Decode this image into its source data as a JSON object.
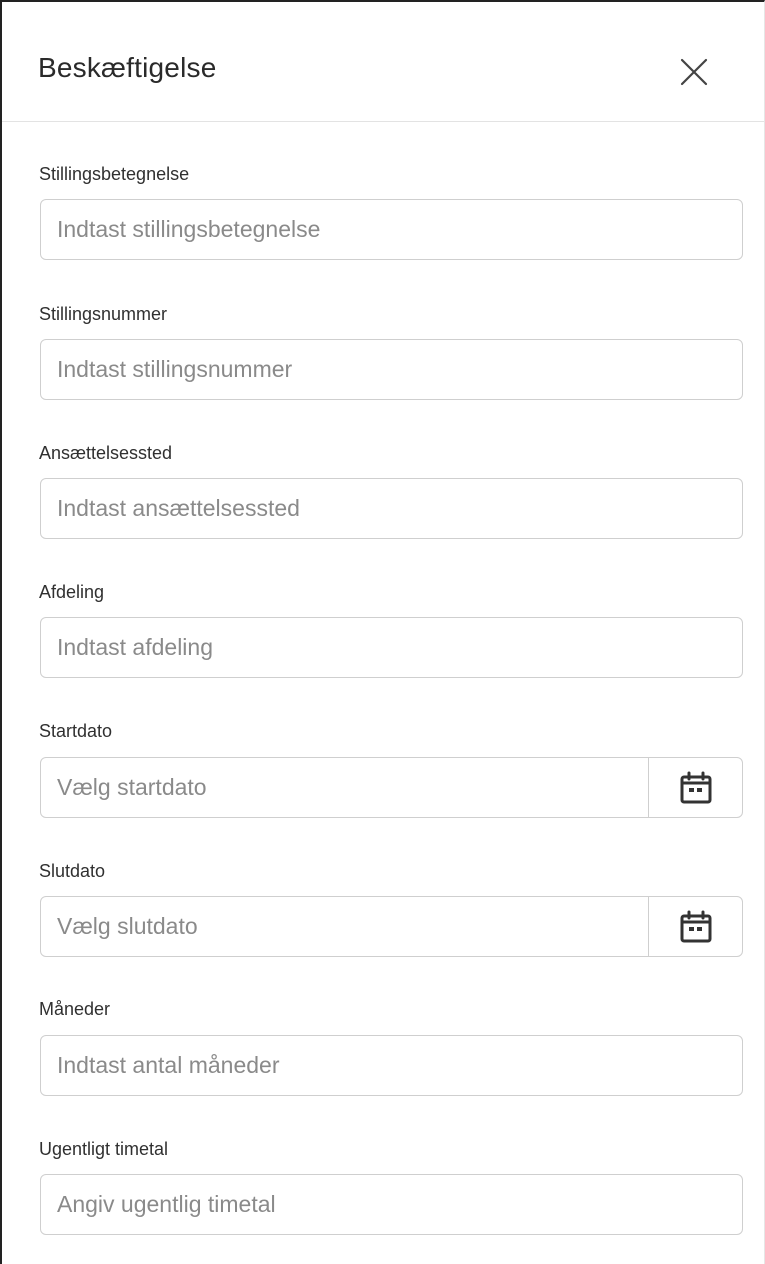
{
  "dialog": {
    "title": "Beskæftigelse",
    "close_icon": "close-icon"
  },
  "fields": {
    "job_title": {
      "label": "Stillingsbetegnelse",
      "placeholder": "Indtast stillingsbetegnelse",
      "value": ""
    },
    "job_number": {
      "label": "Stillingsnummer",
      "placeholder": "Indtast stillingsnummer",
      "value": ""
    },
    "workplace": {
      "label": "Ansættelsessted",
      "placeholder": "Indtast ansættelsessted",
      "value": ""
    },
    "department": {
      "label": "Afdeling",
      "placeholder": "Indtast afdeling",
      "value": ""
    },
    "start_date": {
      "label": "Startdato",
      "placeholder": "Vælg startdato",
      "value": "",
      "icon": "calendar-icon"
    },
    "end_date": {
      "label": "Slutdato",
      "placeholder": "Vælg slutdato",
      "value": "",
      "icon": "calendar-icon"
    },
    "months": {
      "label": "Måneder",
      "placeholder": "Indtast antal måneder",
      "value": ""
    },
    "weekly_hours": {
      "label": "Ugentligt timetal",
      "placeholder": "Angiv ugentlig timetal",
      "value": ""
    }
  },
  "colors": {
    "text": "#333333",
    "placeholder": "#8a8a8a",
    "border": "#cfcfcf"
  }
}
